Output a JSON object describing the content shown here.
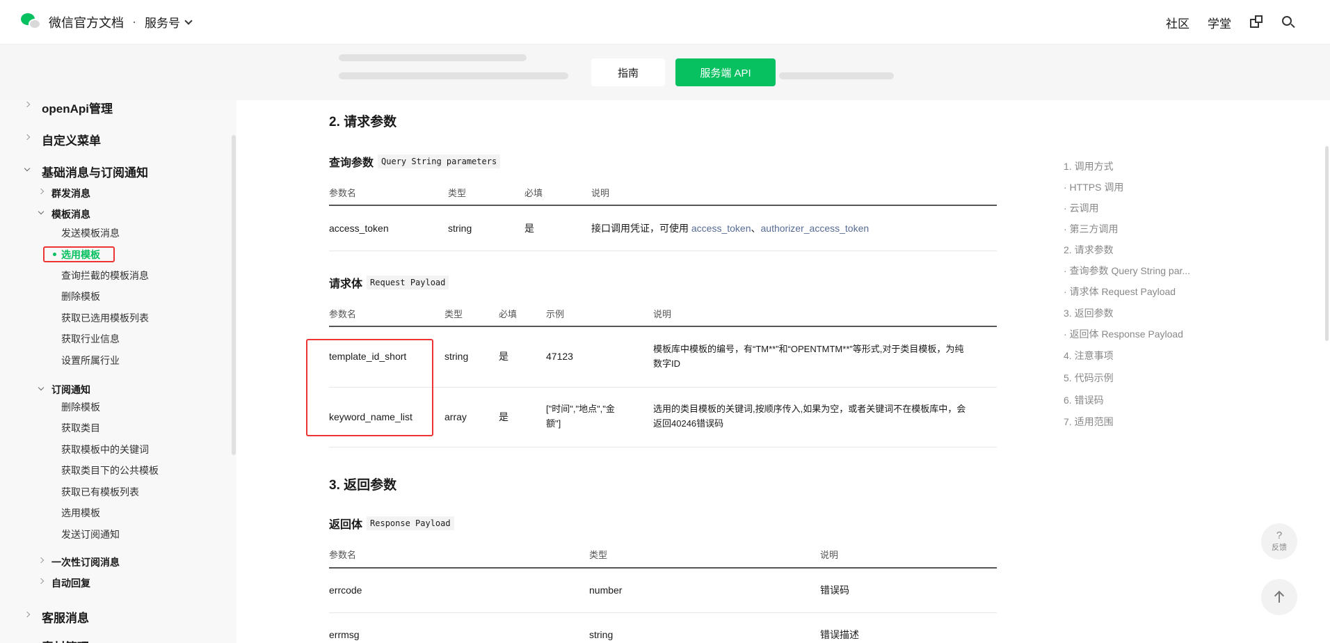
{
  "header": {
    "brand_title": "微信官方文档",
    "brand_dot": "·",
    "brand_sub": "服务号",
    "links": [
      "社区",
      "学堂"
    ]
  },
  "subbar": {
    "tab_guide": "指南",
    "tab_api": "服务端 API"
  },
  "sidebar": {
    "l1_openapi": "openApi管理",
    "l1_menu": "自定义菜单",
    "l1_basic": "基础消息与订阅通知",
    "l2_mass": "群发消息",
    "l2_template": "模板消息",
    "template_items": [
      "发送模板消息",
      "选用模板",
      "查询拦截的模板消息",
      "删除模板",
      "获取已选用模板列表",
      "获取行业信息",
      "设置所属行业"
    ],
    "l2_subscribe": "订阅通知",
    "subscribe_items": [
      "删除模板",
      "获取类目",
      "获取模板中的关键词",
      "获取类目下的公共模板",
      "获取已有模板列表",
      "选用模板",
      "发送订阅通知"
    ],
    "l2_onetime": "一次性订阅消息",
    "l2_autoreply": "自动回复",
    "l1_kf": "客服消息",
    "l1_cut": "素材管理"
  },
  "content": {
    "sec2_title": "2. 请求参数",
    "query_title": "查询参数",
    "query_code": "Query String parameters",
    "query_headers": [
      "参数名",
      "类型",
      "必填",
      "说明"
    ],
    "query_row": {
      "name": "access_token",
      "type": "string",
      "required": "是",
      "desc_prefix": "接口调用凭证，可使用 ",
      "link1": "access_token",
      "sep": "、",
      "link2": "authorizer_access_token"
    },
    "body_title": "请求体",
    "body_code": "Request Payload",
    "body_headers": [
      "参数名",
      "类型",
      "必填",
      "示例",
      "说明"
    ],
    "body_rows": [
      {
        "name": "template_id_short",
        "type": "string",
        "required": "是",
        "example": "47123",
        "desc_line1": "模板库中模板的编号，有“TM**”和“OPENTMTM**”等形式,对于类目模板，为纯",
        "desc_line2": "数字ID"
      },
      {
        "name": "keyword_name_list",
        "type": "array",
        "required": "是",
        "example_line1": "[\"时间\",\"地点\",\"金",
        "example_line2": "额\"]",
        "desc_line1": "选用的类目模板的关键词,按顺序传入,如果为空，或者关键词不在模板库中，会",
        "desc_line2": "返回40246错误码"
      }
    ],
    "sec3_title": "3. 返回参数",
    "resp_title": "返回体",
    "resp_code": "Response Payload",
    "resp_headers": [
      "参数名",
      "类型",
      "说明"
    ],
    "resp_rows": [
      {
        "name": "errcode",
        "type": "number",
        "desc": "错误码"
      },
      {
        "name": "errmsg",
        "type": "string",
        "desc": "错误描述"
      }
    ]
  },
  "toc": [
    "1. 调用方式",
    "· HTTPS 调用",
    "· 云调用",
    "· 第三方调用",
    "2. 请求参数",
    "· 查询参数 Query String par...",
    "· 请求体 Request Payload",
    "3. 返回参数",
    "· 返回体 Response Payload",
    "4. 注意事项",
    "5. 代码示例",
    "6. 错误码",
    "7. 适用范围"
  ],
  "float": {
    "feedback_q": "?",
    "feedback_label": "反馈"
  },
  "colors": {
    "accent": "#07c160",
    "link": "#576b95",
    "highlight_box": "#e33333"
  },
  "icons": [
    "wechat-logo",
    "chevron-down-icon",
    "external-link-icon",
    "search-icon",
    "chevron-right-icon",
    "arrow-up-icon"
  ]
}
